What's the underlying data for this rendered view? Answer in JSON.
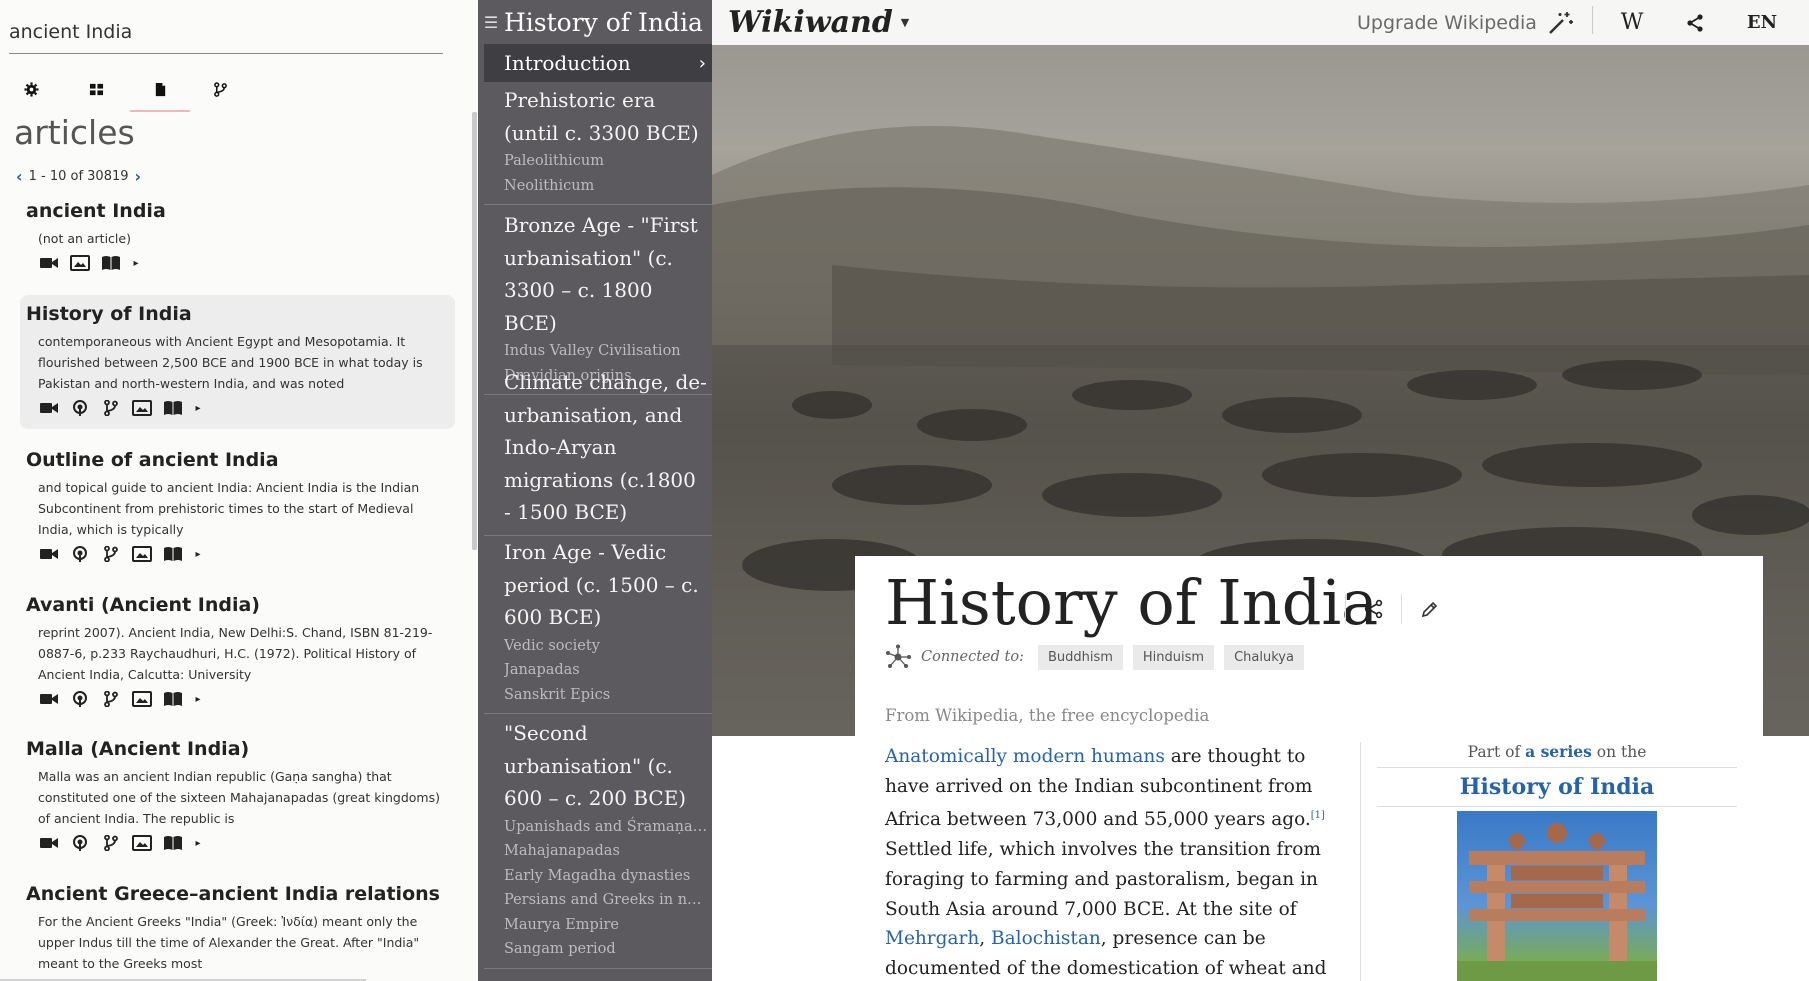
{
  "search": {
    "value": "ancient India"
  },
  "toolbar": {
    "icons": [
      "gear-icon",
      "grid-icon",
      "document-icon",
      "branch-icon"
    ]
  },
  "articles": {
    "heading": "articles",
    "pager": "1 - 10 of 30819"
  },
  "results": [
    {
      "title": "ancient India",
      "snippet": "(not an article)"
    },
    {
      "title": "History of India",
      "snippet": "contemporaneous with Ancient Egypt and Mesopotamia. It flourished between 2,500 BCE and 1900 BCE in what today is Pakistan and north-western India, and was noted"
    },
    {
      "title": "Outline of ancient India",
      "snippet": "and topical guide to ancient India: Ancient India is the Indian Subcontinent from prehistoric times to the start of Medieval India, which is typically"
    },
    {
      "title": "Avanti (Ancient India)",
      "snippet": "reprint 2007). Ancient India, New Delhi:S. Chand, ISBN 81-219-0887-6, p.233 Raychaudhuri, H.C. (1972). Political History of Ancient India, Calcutta: University"
    },
    {
      "title": "Malla (Ancient India)",
      "snippet": "Malla was an ancient Indian republic (Gaṇa sangha) that constituted one of the sixteen Mahajanapadas (great kingdoms) of ancient India. The republic is"
    },
    {
      "title": "Ancient Greece–ancient India relations",
      "snippet": "For the Ancient Greeks \"India\" (Greek: Ἰνδία) meant only the upper Indus till the time of Alexander the Great. After \"India\" meant to the Greeks most"
    }
  ],
  "toc": {
    "title": "History of India",
    "intro": "Introduction",
    "sections": [
      {
        "main": "Prehistoric era (until c. 3300 BCE)",
        "subs": [
          "Paleolithicum",
          "Neolithicum"
        ]
      },
      {
        "main": "Bronze Age - \"First urbanisation\" (c. 3300 – c. 1800 BCE)",
        "subs": [
          "Indus Valley Civilisation",
          "Dravidian origins"
        ]
      },
      {
        "main": "Climate change, de-urbanisation, and Indo-Aryan migrations (c.1800 - 1500 BCE)",
        "subs": []
      },
      {
        "main": "Iron Age - Vedic period (c. 1500 – c. 600 BCE)",
        "subs": [
          "Vedic society",
          "Janapadas",
          "Sanskrit Epics"
        ]
      },
      {
        "main": "\"Second urbanisation\" (c. 600 – c. 200 BCE)",
        "subs": [
          "Upanishads and Śramaṇa movements",
          "Mahajanapadas",
          "Early Magadha dynasties",
          "Persians and Greeks in north-western India",
          "Maurya Empire",
          "Sangam period"
        ]
      }
    ]
  },
  "topbar": {
    "logo": "Wikiwand",
    "upgrade": "Upgrade Wikipedia",
    "wiki_w": "W",
    "lang": "EN"
  },
  "article": {
    "title": "History of India",
    "connected_label": "Connected to:",
    "topics": [
      "Buddhism",
      "Hinduism",
      "Chalukya"
    ],
    "from": "From Wikipedia, the free encyclopedia",
    "body": {
      "link1": "Anatomically modern humans",
      "t1": " are thought to have arrived on the Indian subcontinent from Africa between 73,000 and 55,000 years ago.",
      "ref1": "[1]",
      "t2": " Settled life, which involves the transition from foraging to farming and pastoralism, began in South Asia around 7,000 BCE. At the site of ",
      "link2": "Mehrgarh",
      "t3": ", ",
      "link3": "Balochistan",
      "t4": ", presence can be documented of the domestication of wheat and barley, rapidly followed by that of"
    },
    "infobox": {
      "part_of": "Part of",
      "series_link": "a series",
      "on_the": "on the",
      "title": "History of India"
    }
  },
  "colors": {
    "link": "#2563a9",
    "toc_bg": "#5c5a5f",
    "toc_active": "#3f3e43"
  }
}
